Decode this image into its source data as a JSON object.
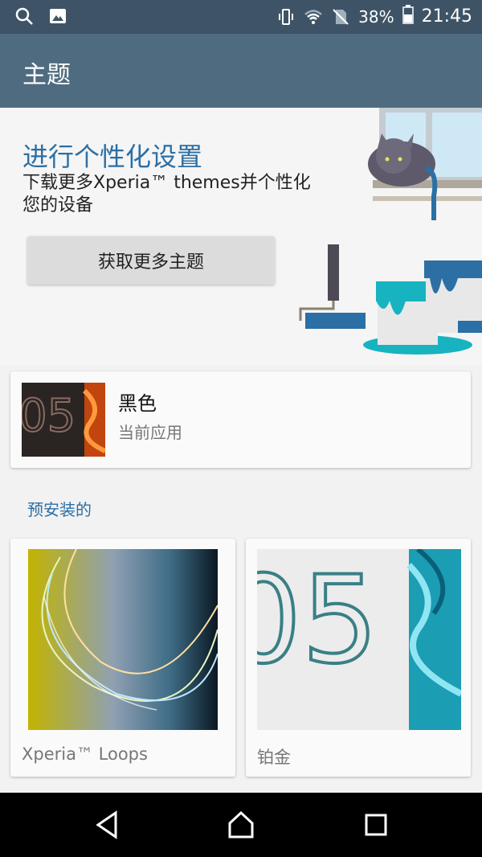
{
  "status_bar": {
    "battery_percent": "38%",
    "time": "21:45",
    "icons": [
      "search-icon",
      "image-icon",
      "vibrate-icon",
      "wifi-icon",
      "no-sim-icon",
      "battery-icon"
    ]
  },
  "app_bar": {
    "title": "主题"
  },
  "hero": {
    "headline": "进行个性化设置",
    "description": "下载更多Xperia™ themes并个性化您的设备",
    "button_label": "获取更多主题"
  },
  "current_theme": {
    "name": "黑色",
    "status": "当前应用"
  },
  "preinstalled": {
    "section_title": "预安装的",
    "themes": [
      {
        "label": "Xperia™ Loops"
      },
      {
        "label": "铂金"
      }
    ]
  },
  "nav_bar": {
    "icons": [
      "back-icon",
      "home-icon",
      "recents-icon"
    ]
  },
  "colors": {
    "status_bar": "#3e5466",
    "app_bar": "#4f6b80",
    "accent": "#2b6fa5"
  }
}
